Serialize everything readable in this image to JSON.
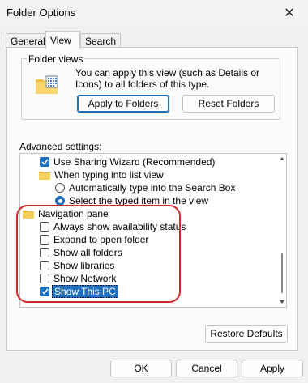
{
  "window": {
    "title": "Folder Options"
  },
  "tabs": [
    {
      "label": "General"
    },
    {
      "label": "View"
    },
    {
      "label": "Search"
    }
  ],
  "folder_views": {
    "label": "Folder views",
    "description": "You can apply this view (such as Details or Icons) to all folders of this type.",
    "apply_button": "Apply to Folders",
    "reset_button": "Reset Folders"
  },
  "advanced": {
    "label": "Advanced settings:",
    "items": [
      {
        "type": "checkbox",
        "label": "Use Sharing Wizard (Recommended)",
        "checked": true
      },
      {
        "type": "folder",
        "label": "When typing into list view"
      },
      {
        "type": "radio",
        "label": "Automatically type into the Search Box",
        "checked": false
      },
      {
        "type": "radio",
        "label": "Select the typed item in the view",
        "checked": true
      },
      {
        "type": "folder",
        "label": "Navigation pane"
      },
      {
        "type": "checkbox",
        "label": "Always show availability status",
        "checked": false
      },
      {
        "type": "checkbox",
        "label": "Expand to open folder",
        "checked": false
      },
      {
        "type": "checkbox",
        "label": "Show all folders",
        "checked": false
      },
      {
        "type": "checkbox",
        "label": "Show libraries",
        "checked": false
      },
      {
        "type": "checkbox",
        "label": "Show Network",
        "checked": false
      },
      {
        "type": "checkbox",
        "label": "Show This PC",
        "checked": true,
        "selected": true
      }
    ]
  },
  "restore_button": "Restore Defaults",
  "footer": {
    "ok": "OK",
    "cancel": "Cancel",
    "apply": "Apply"
  },
  "colors": {
    "accent": "#1f6fc0",
    "annotation": "#d4262d"
  }
}
